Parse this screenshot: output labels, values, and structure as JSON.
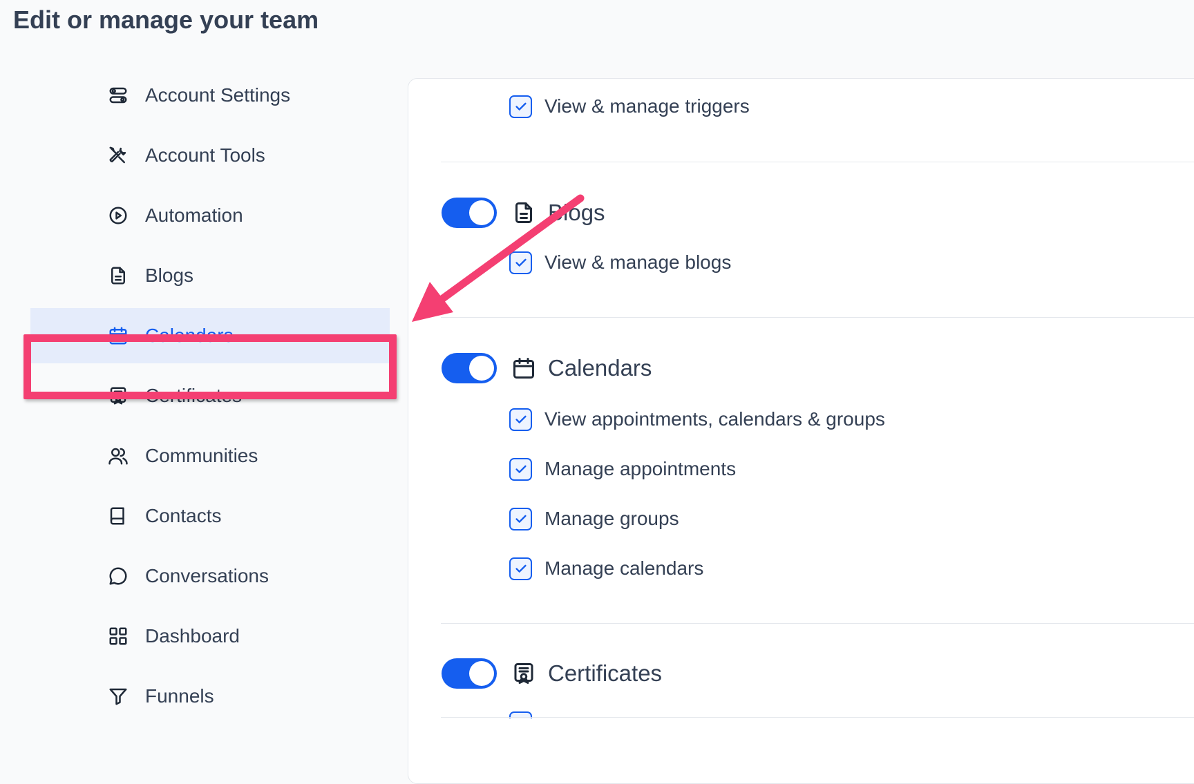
{
  "page": {
    "title": "Edit or manage your team"
  },
  "sidebar": {
    "items": [
      {
        "label": "Account Settings",
        "icon": "toggles-icon"
      },
      {
        "label": "Account Tools",
        "icon": "tools-icon"
      },
      {
        "label": "Automation",
        "icon": "play-circle-icon"
      },
      {
        "label": "Blogs",
        "icon": "document-icon"
      },
      {
        "label": "Calendars",
        "icon": "calendar-icon",
        "active": true
      },
      {
        "label": "Certificates",
        "icon": "certificate-icon"
      },
      {
        "label": "Communities",
        "icon": "users-icon"
      },
      {
        "label": "Contacts",
        "icon": "book-icon"
      },
      {
        "label": "Conversations",
        "icon": "chat-bubble-icon"
      },
      {
        "label": "Dashboard",
        "icon": "grid-icon"
      },
      {
        "label": "Funnels",
        "icon": "filter-icon"
      }
    ]
  },
  "panel": {
    "automation_perms": [
      "View & manage triggers"
    ],
    "blogs": {
      "title": "Blogs",
      "enabled": true,
      "perms": [
        "View & manage blogs"
      ]
    },
    "calendars": {
      "title": "Calendars",
      "enabled": true,
      "perms": [
        "View appointments, calendars & groups",
        "Manage appointments",
        "Manage groups",
        "Manage calendars"
      ]
    },
    "certificates": {
      "title": "Certificates",
      "enabled": true
    }
  },
  "colors": {
    "accent": "#155eef",
    "active_bg": "#e5ecfb",
    "annotation": "#f43f72"
  }
}
